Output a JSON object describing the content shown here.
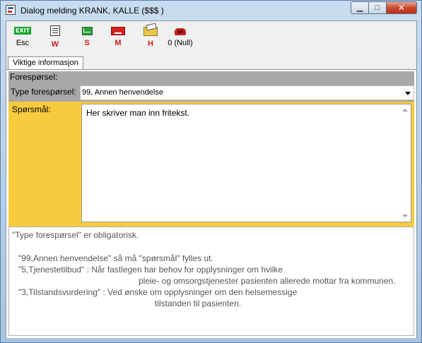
{
  "window": {
    "title": "Dialog melding KRANK, KALLE ($$$ )",
    "controls": {
      "minimize": "▁",
      "maximize": "□",
      "close": "✕"
    }
  },
  "toolbar": {
    "buttons": [
      {
        "id": "esc",
        "label": "Esc",
        "icon": "exit-icon",
        "icon_text": "EXIT"
      },
      {
        "id": "w",
        "label": "W",
        "icon": "document-icon"
      },
      {
        "id": "s",
        "label": "S",
        "icon": "green-envelope-icon"
      },
      {
        "id": "m",
        "label": "M",
        "icon": "red-envelope-icon"
      },
      {
        "id": "h",
        "label": "H",
        "icon": "folder-icon"
      },
      {
        "id": "null",
        "label": "0 (Null)",
        "icon": "phone-icon"
      }
    ]
  },
  "tabs": [
    {
      "label": "Viktige informasjon",
      "active": true
    }
  ],
  "form": {
    "section_label": "Forespørsel:",
    "type_label": "Type forespørsel:",
    "type_value": "99, Annen henvendelse",
    "question_label": "Spørsmål:",
    "question_text": "Her skriver man inn fritekst."
  },
  "help": {
    "lines": [
      "\"Type forespørsel\" er obligatorisk.",
      "\"99,Annen henvendelse\" så må \"spørsmål\" fylles ut.",
      "\"5,Tjenestetilbud\" : Når fastlegen har behov for opplysninger om hvilke",
      "pleie- og omsorgstjenester pasienten allerede mottar fra kommunen.",
      "\"3,Tilstandsvurdering\" : Ved ønske om opplysninger om den helsemessige",
      "tilstanden til pasienten."
    ]
  },
  "colors": {
    "required_field_bg": "#f6cb3d",
    "label_bg": "#a8a8a8",
    "close_button": "#c9472d",
    "toolbar_label_red": "#d11a1a"
  }
}
